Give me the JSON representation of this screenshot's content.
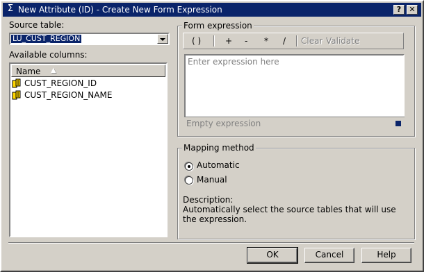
{
  "window": {
    "title": "New Attribute (ID) - Create New Form Expression",
    "title_icon": "sigma-icon",
    "help_button": "?",
    "close_button": "X"
  },
  "left": {
    "source_table_label": "Source table:",
    "source_table_value": "LU_CUST_REGION",
    "available_columns_label": "Available columns:",
    "list_header": "Name",
    "columns": [
      {
        "name": "CUST_REGION_ID",
        "icon": "column-icon"
      },
      {
        "name": "CUST_REGION_NAME",
        "icon": "column-icon"
      }
    ]
  },
  "form_expression": {
    "legend": "Form expression",
    "toolbar": {
      "parens": "( )",
      "plus": "+",
      "minus": "-",
      "multiply": "*",
      "divide": "/",
      "clear": "Clear",
      "validate": "Validate"
    },
    "placeholder": "Enter expression here",
    "status": "Empty expression"
  },
  "mapping": {
    "legend": "Mapping method",
    "automatic_label": "Automatic",
    "manual_label": "Manual",
    "selected": "Automatic",
    "description_label": "Description:",
    "description_text": "Automatically select the source tables that will use the expression."
  },
  "buttons": {
    "ok": "OK",
    "cancel": "Cancel",
    "help": "Help"
  },
  "colors": {
    "titlebar": "#0a246a",
    "face": "#d4d0c8"
  }
}
